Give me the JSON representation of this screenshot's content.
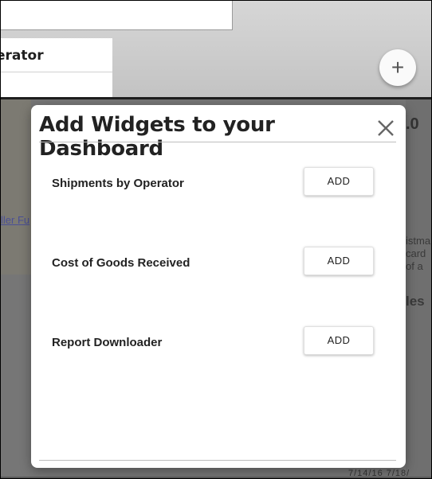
{
  "background": {
    "card_title_fragment": "erator",
    "fab_label": "+",
    "link_fragment": "ller Fu",
    "right_number": ".0",
    "right_text_lines": [
      "istma",
      "card",
      "of a"
    ],
    "right_heading_fragment": "les",
    "dates": "7/14/16  7/18/"
  },
  "modal": {
    "title": "Add Widgets to your Dashboard",
    "close_icon": "close-icon",
    "widgets": [
      {
        "name": "Shipments by Operator",
        "button": "ADD"
      },
      {
        "name": "Cost of Goods Received",
        "button": "ADD"
      },
      {
        "name": "Report Downloader",
        "button": "ADD"
      }
    ]
  }
}
